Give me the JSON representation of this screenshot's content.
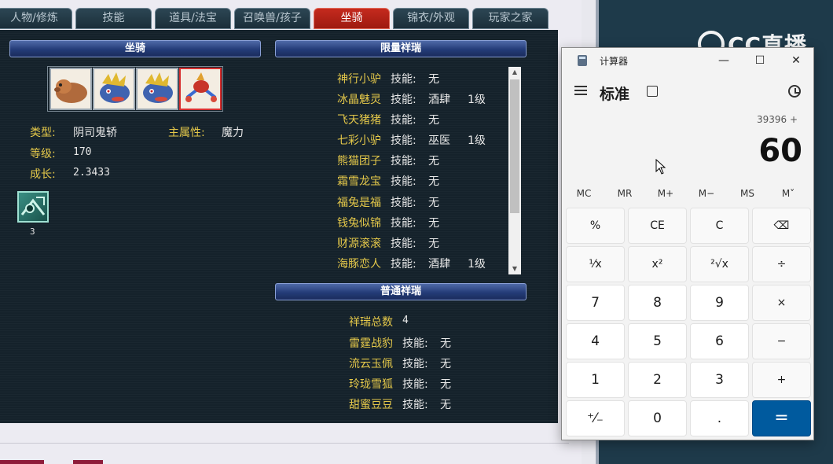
{
  "tabs": [
    {
      "label": "人物/修炼",
      "active": false
    },
    {
      "label": "技能",
      "active": false
    },
    {
      "label": "道具/法宝",
      "active": false
    },
    {
      "label": "召唤兽/孩子",
      "active": false
    },
    {
      "label": "坐骑",
      "active": true
    },
    {
      "label": "锦衣/外观",
      "active": false
    },
    {
      "label": "玩家之家",
      "active": false
    }
  ],
  "mount_panel": {
    "header": "坐骑",
    "mounts": [
      {
        "name": "capybara-mount-icon"
      },
      {
        "name": "blue-beast-mount-icon"
      },
      {
        "name": "blue-beast-mount-icon"
      },
      {
        "name": "red-bird-mount-icon",
        "selected": true
      }
    ],
    "type_label": "类型:",
    "type_value": "阴司鬼轿",
    "attr_label": "主属性:",
    "attr_value": "魔力",
    "level_label": "等级:",
    "level_value": "170",
    "growth_label": "成长:",
    "growth_value": "2.3433",
    "skill_count": "3"
  },
  "limited": {
    "header": "限量祥瑞",
    "skill_label": "技能:",
    "items": [
      {
        "name": "神行小驴",
        "skill": "无",
        "level": ""
      },
      {
        "name": "冰晶魅灵",
        "skill": "酒肆",
        "level": "1级"
      },
      {
        "name": "飞天猪猪",
        "skill": "无",
        "level": ""
      },
      {
        "name": "七彩小驴",
        "skill": "巫医",
        "level": "1级"
      },
      {
        "name": "熊猫团子",
        "skill": "无",
        "level": ""
      },
      {
        "name": "霜雪龙宝",
        "skill": "无",
        "level": ""
      },
      {
        "name": "福兔是福",
        "skill": "无",
        "level": ""
      },
      {
        "name": "钱兔似锦",
        "skill": "无",
        "level": ""
      },
      {
        "name": "财源滚滚",
        "skill": "无",
        "level": ""
      },
      {
        "name": "海豚恋人",
        "skill": "酒肆",
        "level": "1级"
      }
    ]
  },
  "normal": {
    "header": "普通祥瑞",
    "total_label": "祥瑞总数",
    "total_value": "4",
    "skill_label": "技能:",
    "items": [
      {
        "name": "雷霆战豹",
        "skill": "无"
      },
      {
        "name": "流云玉佩",
        "skill": "无"
      },
      {
        "name": "玲珑雪狐",
        "skill": "无"
      },
      {
        "name": "甜蜜豆豆",
        "skill": "无"
      }
    ]
  },
  "brand": "CC直播",
  "calculator": {
    "title": "计算器",
    "mode": "标准",
    "expression": "39396 +",
    "display": "60",
    "memory": [
      "MC",
      "MR",
      "M+",
      "M−",
      "MS",
      "M˅"
    ],
    "keys": [
      [
        "%",
        "CE",
        "C",
        "⌫"
      ],
      [
        "¹⁄x",
        "x²",
        "²√x",
        "÷"
      ],
      [
        "7",
        "8",
        "9",
        "×"
      ],
      [
        "4",
        "5",
        "6",
        "−"
      ],
      [
        "1",
        "2",
        "3",
        "+"
      ],
      [
        "⁺⁄₋",
        "0",
        ".",
        "="
      ]
    ],
    "window_buttons": [
      "—",
      "☐",
      "✕"
    ]
  }
}
